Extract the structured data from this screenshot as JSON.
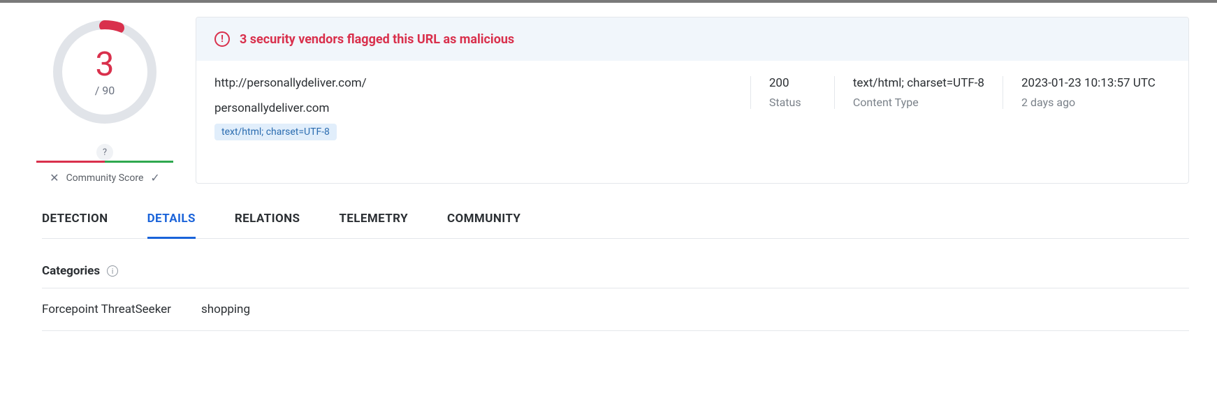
{
  "score": {
    "detections": "3",
    "total": "/ 90",
    "help": "?"
  },
  "community": {
    "label": "Community Score"
  },
  "alert": {
    "text": "3 security vendors flagged this URL as malicious"
  },
  "resource": {
    "url": "http://personallydeliver.com/",
    "domain": "personallydeliver.com",
    "chip": "text/html; charset=UTF-8"
  },
  "meta": {
    "status_value": "200",
    "status_label": "Status",
    "content_type_value": "text/html; charset=UTF-8",
    "content_type_label": "Content Type",
    "timestamp_value": "2023-01-23 10:13:57 UTC",
    "timestamp_label": "2 days ago"
  },
  "tabs": {
    "detection": "DETECTION",
    "details": "DETAILS",
    "relations": "RELATIONS",
    "telemetry": "TELEMETRY",
    "community": "COMMUNITY"
  },
  "categories": {
    "title": "Categories",
    "rows": [
      {
        "vendor": "Forcepoint ThreatSeeker",
        "value": "shopping"
      }
    ]
  }
}
